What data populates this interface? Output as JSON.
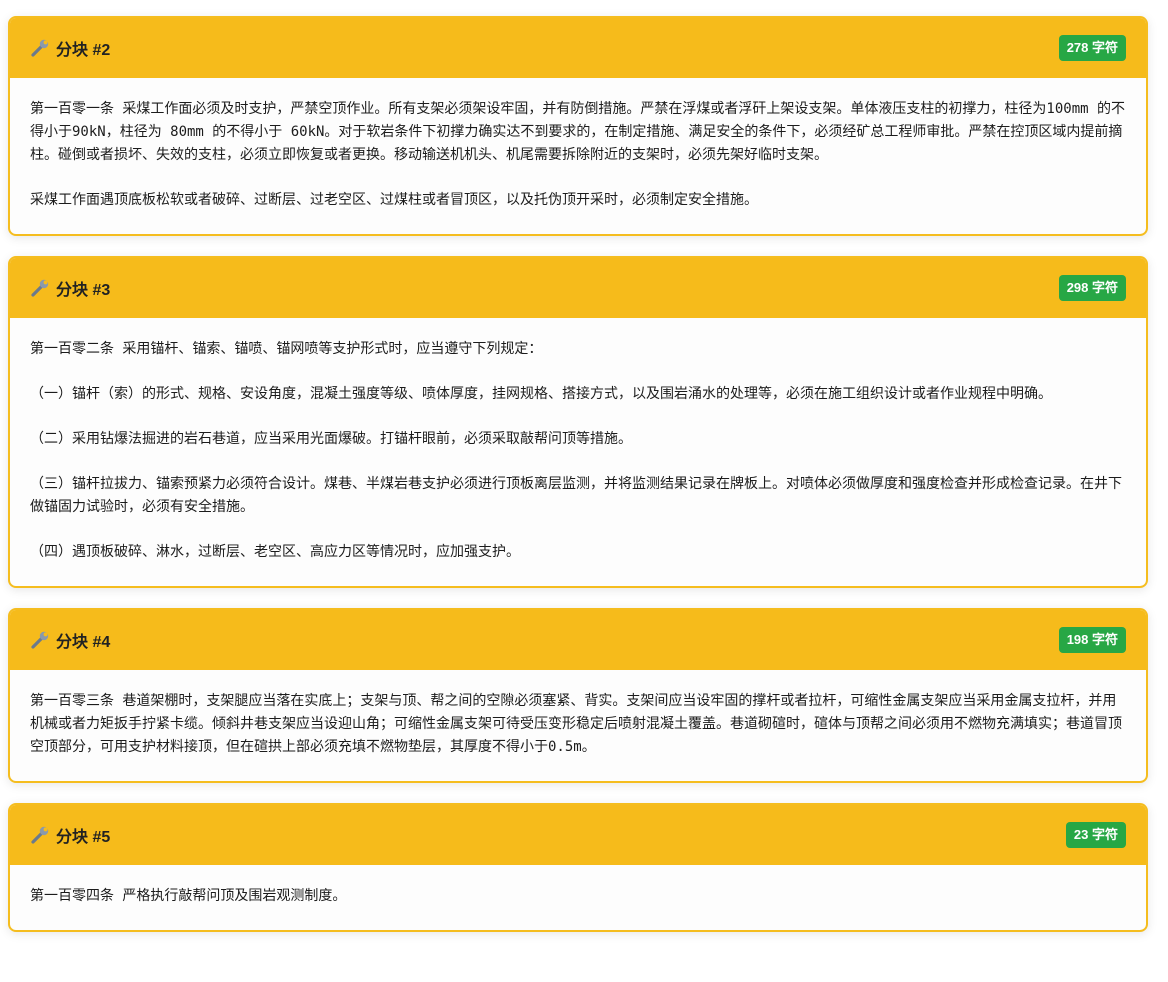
{
  "chunks": [
    {
      "title": "分块 #2",
      "count": "278 字符",
      "paragraphs": [
        "第一百零一条 采煤工作面必须及时支护，严禁空顶作业。所有支架必须架设牢固，并有防倒措施。严禁在浮煤或者浮矸上架设支架。单体液压支柱的初撑力，柱径为100mm 的不得小于90kN，柱径为 80mm 的不得小于 60kN。对于软岩条件下初撑力确实达不到要求的，在制定措施、满足安全的条件下，必须经矿总工程师审批。严禁在控顶区域内提前摘柱。碰倒或者损坏、失效的支柱，必须立即恢复或者更换。移动输送机机头、机尾需要拆除附近的支架时，必须先架好临时支架。",
        "采煤工作面遇顶底板松软或者破碎、过断层、过老空区、过煤柱或者冒顶区，以及托伪顶开采时，必须制定安全措施。"
      ]
    },
    {
      "title": "分块 #3",
      "count": "298 字符",
      "paragraphs": [
        "第一百零二条 采用锚杆、锚索、锚喷、锚网喷等支护形式时，应当遵守下列规定：",
        "（一）锚杆（索）的形式、规格、安设角度，混凝土强度等级、喷体厚度，挂网规格、搭接方式，以及围岩涌水的处理等，必须在施工组织设计或者作业规程中明确。",
        "（二）采用钻爆法掘进的岩石巷道，应当采用光面爆破。打锚杆眼前，必须采取敲帮问顶等措施。",
        "（三）锚杆拉拔力、锚索预紧力必须符合设计。煤巷、半煤岩巷支护必须进行顶板离层监测，并将监测结果记录在牌板上。对喷体必须做厚度和强度检查并形成检查记录。在井下做锚固力试验时，必须有安全措施。",
        "（四）遇顶板破碎、淋水，过断层、老空区、高应力区等情况时，应加强支护。"
      ]
    },
    {
      "title": "分块 #4",
      "count": "198 字符",
      "paragraphs": [
        "第一百零三条 巷道架棚时，支架腿应当落在实底上；支架与顶、帮之间的空隙必须塞紧、背实。支架间应当设牢固的撑杆或者拉杆，可缩性金属支架应当采用金属支拉杆，并用机械或者力矩扳手拧紧卡缆。倾斜井巷支架应当设迎山角；可缩性金属支架可待受压变形稳定后喷射混凝土覆盖。巷道砌碹时，碹体与顶帮之间必须用不燃物充满填实；巷道冒顶空顶部分，可用支护材料接顶，但在碹拱上部必须充填不燃物垫层，其厚度不得小于0.5m。"
      ]
    },
    {
      "title": "分块 #5",
      "count": "23 字符",
      "paragraphs": [
        "第一百零四条 严格执行敲帮问顶及围岩观测制度。"
      ]
    }
  ],
  "icons": {
    "chunk_icon": "wrench-icon"
  },
  "colors": {
    "header_bg": "#f6bb1b",
    "border": "#f5bd1f",
    "badge_bg": "#27a745",
    "badge_text": "#ffffff"
  }
}
